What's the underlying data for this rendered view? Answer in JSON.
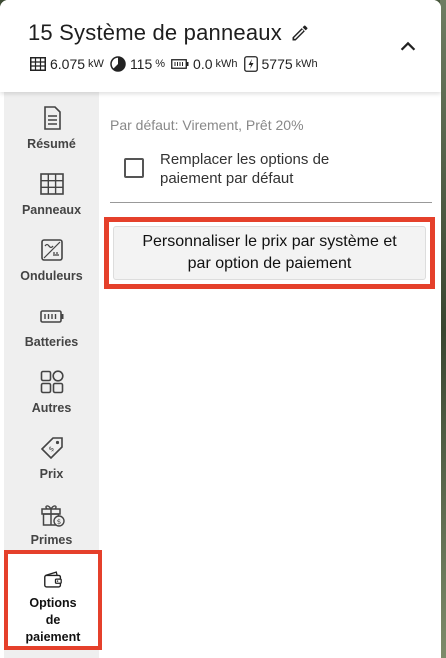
{
  "header": {
    "title": "15 Système de panneaux",
    "stats": {
      "power_value": "6.075",
      "power_unit": "kW",
      "offset_value": "115",
      "offset_unit": "%",
      "battery_value": "0.0",
      "battery_unit": "kWh",
      "production_value": "5775",
      "production_unit": "kWh"
    }
  },
  "sidebar": {
    "items": [
      {
        "label": "Résumé",
        "icon": "document-icon"
      },
      {
        "label": "Panneaux",
        "icon": "grid-icon"
      },
      {
        "label": "Onduleurs",
        "icon": "inverter-icon"
      },
      {
        "label": "Batteries",
        "icon": "battery-icon"
      },
      {
        "label": "Autres",
        "icon": "shapes-icon"
      },
      {
        "label": "Prix",
        "icon": "price-tag-icon"
      },
      {
        "label": "Primes",
        "icon": "gift-icon"
      }
    ],
    "active": {
      "label_line1": "Options",
      "label_line2": "de",
      "label_line3": "paiement",
      "icon": "wallet-icon"
    }
  },
  "content": {
    "default_text": "Par défaut: Virement, Prêt 20%",
    "checkbox_label": "Remplacer les options de paiement par défaut",
    "checkbox_checked": false,
    "cta_label_line1": "Personnaliser le prix par système et",
    "cta_label_line2": "par option de paiement"
  },
  "colors": {
    "highlight": "#e5402b",
    "sidebar_bg": "#efefef"
  }
}
